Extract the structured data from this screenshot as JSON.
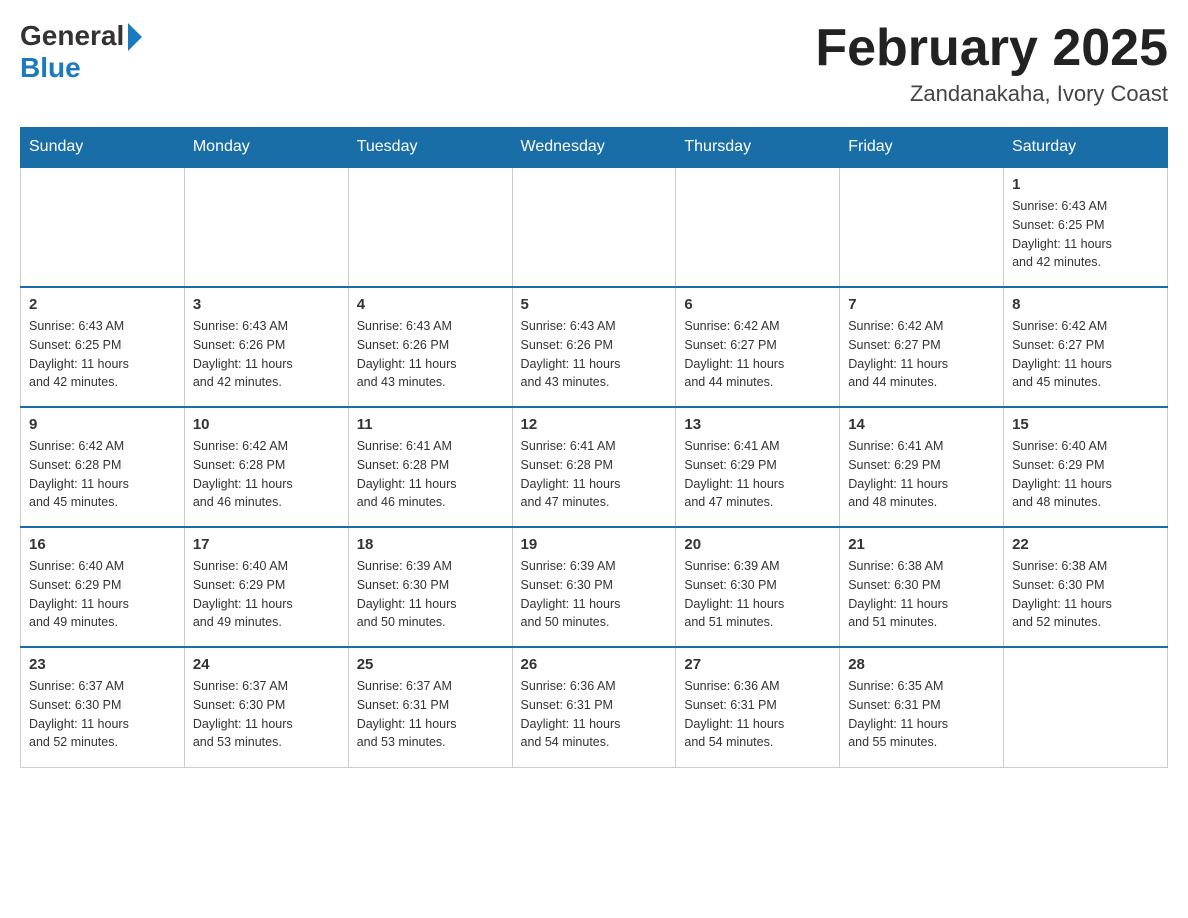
{
  "header": {
    "logo_general": "General",
    "logo_blue": "Blue",
    "month_title": "February 2025",
    "location": "Zandanakaha, Ivory Coast"
  },
  "days_of_week": [
    "Sunday",
    "Monday",
    "Tuesday",
    "Wednesday",
    "Thursday",
    "Friday",
    "Saturday"
  ],
  "weeks": [
    [
      {
        "day": "",
        "info": ""
      },
      {
        "day": "",
        "info": ""
      },
      {
        "day": "",
        "info": ""
      },
      {
        "day": "",
        "info": ""
      },
      {
        "day": "",
        "info": ""
      },
      {
        "day": "",
        "info": ""
      },
      {
        "day": "1",
        "info": "Sunrise: 6:43 AM\nSunset: 6:25 PM\nDaylight: 11 hours\nand 42 minutes."
      }
    ],
    [
      {
        "day": "2",
        "info": "Sunrise: 6:43 AM\nSunset: 6:25 PM\nDaylight: 11 hours\nand 42 minutes."
      },
      {
        "day": "3",
        "info": "Sunrise: 6:43 AM\nSunset: 6:26 PM\nDaylight: 11 hours\nand 42 minutes."
      },
      {
        "day": "4",
        "info": "Sunrise: 6:43 AM\nSunset: 6:26 PM\nDaylight: 11 hours\nand 43 minutes."
      },
      {
        "day": "5",
        "info": "Sunrise: 6:43 AM\nSunset: 6:26 PM\nDaylight: 11 hours\nand 43 minutes."
      },
      {
        "day": "6",
        "info": "Sunrise: 6:42 AM\nSunset: 6:27 PM\nDaylight: 11 hours\nand 44 minutes."
      },
      {
        "day": "7",
        "info": "Sunrise: 6:42 AM\nSunset: 6:27 PM\nDaylight: 11 hours\nand 44 minutes."
      },
      {
        "day": "8",
        "info": "Sunrise: 6:42 AM\nSunset: 6:27 PM\nDaylight: 11 hours\nand 45 minutes."
      }
    ],
    [
      {
        "day": "9",
        "info": "Sunrise: 6:42 AM\nSunset: 6:28 PM\nDaylight: 11 hours\nand 45 minutes."
      },
      {
        "day": "10",
        "info": "Sunrise: 6:42 AM\nSunset: 6:28 PM\nDaylight: 11 hours\nand 46 minutes."
      },
      {
        "day": "11",
        "info": "Sunrise: 6:41 AM\nSunset: 6:28 PM\nDaylight: 11 hours\nand 46 minutes."
      },
      {
        "day": "12",
        "info": "Sunrise: 6:41 AM\nSunset: 6:28 PM\nDaylight: 11 hours\nand 47 minutes."
      },
      {
        "day": "13",
        "info": "Sunrise: 6:41 AM\nSunset: 6:29 PM\nDaylight: 11 hours\nand 47 minutes."
      },
      {
        "day": "14",
        "info": "Sunrise: 6:41 AM\nSunset: 6:29 PM\nDaylight: 11 hours\nand 48 minutes."
      },
      {
        "day": "15",
        "info": "Sunrise: 6:40 AM\nSunset: 6:29 PM\nDaylight: 11 hours\nand 48 minutes."
      }
    ],
    [
      {
        "day": "16",
        "info": "Sunrise: 6:40 AM\nSunset: 6:29 PM\nDaylight: 11 hours\nand 49 minutes."
      },
      {
        "day": "17",
        "info": "Sunrise: 6:40 AM\nSunset: 6:29 PM\nDaylight: 11 hours\nand 49 minutes."
      },
      {
        "day": "18",
        "info": "Sunrise: 6:39 AM\nSunset: 6:30 PM\nDaylight: 11 hours\nand 50 minutes."
      },
      {
        "day": "19",
        "info": "Sunrise: 6:39 AM\nSunset: 6:30 PM\nDaylight: 11 hours\nand 50 minutes."
      },
      {
        "day": "20",
        "info": "Sunrise: 6:39 AM\nSunset: 6:30 PM\nDaylight: 11 hours\nand 51 minutes."
      },
      {
        "day": "21",
        "info": "Sunrise: 6:38 AM\nSunset: 6:30 PM\nDaylight: 11 hours\nand 51 minutes."
      },
      {
        "day": "22",
        "info": "Sunrise: 6:38 AM\nSunset: 6:30 PM\nDaylight: 11 hours\nand 52 minutes."
      }
    ],
    [
      {
        "day": "23",
        "info": "Sunrise: 6:37 AM\nSunset: 6:30 PM\nDaylight: 11 hours\nand 52 minutes."
      },
      {
        "day": "24",
        "info": "Sunrise: 6:37 AM\nSunset: 6:30 PM\nDaylight: 11 hours\nand 53 minutes."
      },
      {
        "day": "25",
        "info": "Sunrise: 6:37 AM\nSunset: 6:31 PM\nDaylight: 11 hours\nand 53 minutes."
      },
      {
        "day": "26",
        "info": "Sunrise: 6:36 AM\nSunset: 6:31 PM\nDaylight: 11 hours\nand 54 minutes."
      },
      {
        "day": "27",
        "info": "Sunrise: 6:36 AM\nSunset: 6:31 PM\nDaylight: 11 hours\nand 54 minutes."
      },
      {
        "day": "28",
        "info": "Sunrise: 6:35 AM\nSunset: 6:31 PM\nDaylight: 11 hours\nand 55 minutes."
      },
      {
        "day": "",
        "info": ""
      }
    ]
  ]
}
